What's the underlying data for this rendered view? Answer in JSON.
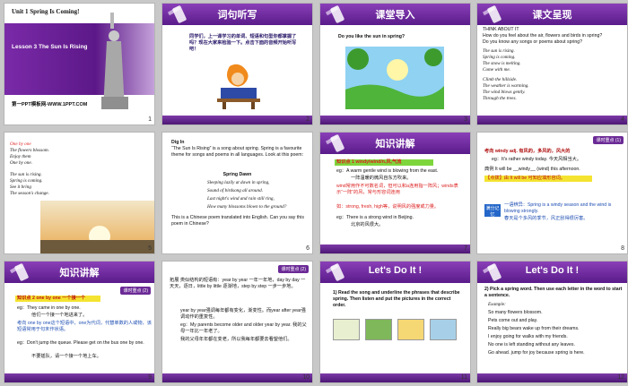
{
  "colors": {
    "header_purple": "#6b2a96",
    "accent_red": "#d22222",
    "accent_blue": "#1f4fb3",
    "highlight_green": "#7ed63c",
    "highlight_yellow": "#f4e431"
  },
  "slides": [
    {
      "num": "1",
      "unit": "Unit 1   Spring Is Coming!",
      "lesson": "Lesson 3   The Sun Is Rising",
      "site": "第一PPT模板网-WWW.1PPT.COM"
    },
    {
      "num": "2",
      "title": "词句听写",
      "body": "同学们，上一课学习的单词、短语和句型你都掌握了吗？现在大家来检验一下。点击下面的音频开始听写吧！"
    },
    {
      "num": "3",
      "title": "课堂导入",
      "question": "Do you like the sun in spring?"
    },
    {
      "num": "4",
      "title": "课文呈现",
      "lines": [
        "THINK ABOUT IT",
        "How do you feel about the air, flowers and birds in spring?",
        "Do you know any songs or poems about spring?",
        "The sun is rising.",
        "Spring is coming.",
        "The snow is melting.",
        "Come with me.",
        "Climb the hillside.",
        "The weather is warming.",
        "The wind blows gently.",
        "Through the trees."
      ]
    },
    {
      "num": "5",
      "lines": [
        "One by one",
        "The flowers blossom.",
        "Enjoy them",
        "One by one.",
        "The sun is rising.",
        "Spring is coming.",
        "See it bring",
        "The season's change."
      ]
    },
    {
      "num": "6",
      "dig": "Dig In",
      "p1": "“The Sun Is Rising” is a song about spring. Spring is a favourite theme for songs and poems in all languages. Look at this poem:",
      "poem_title": "Spring Dawn",
      "poem": [
        "Sleeping lazily at dawn in spring,",
        "Sound of birdsong all around.",
        "Last night's wind and rain still ring,",
        "How many blossoms blown to the ground?"
      ],
      "p2": "This is a Chinese poem translated into English.  Can you say this poem in Chinese?"
    },
    {
      "num": "7",
      "title": "知识讲解",
      "tag": "课时重点 (1)",
      "point": "知识点 1  windy/wind/n.风,气流",
      "lines": [
        "eg：A warm gentle wind is blowing from the east.",
        "一阵温暖的微风自东方吹来。",
        "wind常用作不可数名词，但可以和a连用指一阵风；winds表示“一阵”的风，常与形容词连用",
        "如：strong, fresh, high等，说明风的强度或力量。",
        "eg：There is a strong wind in Beijing.",
        "北京的风很大。"
      ]
    },
    {
      "num": "8",
      "tag": "课时重点 (1)",
      "lines": [
        "考向 windy adj. 有风的，多风的，风大的",
        "eg：It's rather windy today. 今天风相当大。",
        "典例  It will be __windy__ (wind) this afternoon.",
        "【点拨】由 It will be 可知应填形容词。",
        "一语辨异：Spring is a windy season and the wind is blowing strongly.",
        "春天是个多风的季节，风正刮得很厉害。"
      ],
      "box": "满分记忆"
    },
    {
      "num": "9",
      "title": "知识讲解",
      "tag": "课时重点 (2)",
      "point": "知识点 2  one by one 一个接一个",
      "lines": [
        "eg：They came in one by one.",
        "他们一个接一个地进来了。",
        "考向 one by one这个短语中，one为代词，代替单数的人或物，该短语常用于句末作状语。",
        "eg：Don't jump the queue. Please get on the bus one by one.",
        "不要插队，请一个接一个地上车。"
      ]
    },
    {
      "num": "10",
      "tag": "课时重点 (2)",
      "lines": [
        "拓展 类似结构的短语有：year by year 一年一年地，day by day 一天天，逐日，little by little 逐渐地，step by step 一步一步地。",
        "year by year强调每年都有变化，渐变性。而year after year强调动作的重复性。",
        "eg：My parents become older and older year by year. 我的父母一年比一年老了。",
        "我的父母年年都在变老，所以我每年都要去看望他们。"
      ]
    },
    {
      "num": "11",
      "title": "Let's Do It !",
      "text": "1) Read the song and underline the phrases that describe spring. Then listen and put the pictures in the correct order."
    },
    {
      "num": "12",
      "title": "Let's Do It !",
      "lines": [
        "2) Pick a spring word. Then use each letter in the word to start a sentence.",
        "Example:",
        "So many flowers blossom.",
        "Pets come out and play.",
        "Really big bears wake up from their dreams.",
        "I enjoy going for walks with my friends.",
        "No one is left standing without any leaves.",
        "Go ahead.  jump for joy because spring is here."
      ]
    }
  ]
}
